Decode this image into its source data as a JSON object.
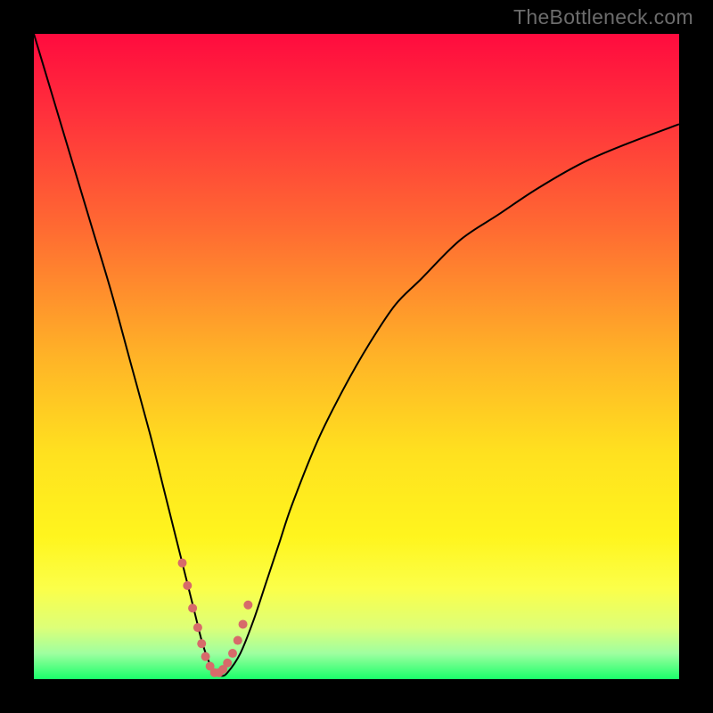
{
  "watermark": "TheBottleneck.com",
  "chart_data": {
    "type": "line",
    "title": "",
    "xlabel": "",
    "ylabel": "",
    "xlim": [
      0,
      100
    ],
    "ylim": [
      0,
      100
    ],
    "legend": false,
    "grid": false,
    "background": {
      "type": "vertical-gradient",
      "stops": [
        {
          "pos": 0.0,
          "color": "#ff0b3e"
        },
        {
          "pos": 0.12,
          "color": "#ff2f3c"
        },
        {
          "pos": 0.3,
          "color": "#ff6a32"
        },
        {
          "pos": 0.5,
          "color": "#ffb327"
        },
        {
          "pos": 0.65,
          "color": "#ffe11f"
        },
        {
          "pos": 0.78,
          "color": "#fff51e"
        },
        {
          "pos": 0.86,
          "color": "#fbff4a"
        },
        {
          "pos": 0.92,
          "color": "#ddff78"
        },
        {
          "pos": 0.96,
          "color": "#9fffa0"
        },
        {
          "pos": 1.0,
          "color": "#1aff6a"
        }
      ]
    },
    "series": [
      {
        "name": "bottleneck-curve",
        "color": "#000000",
        "width": 2,
        "x": [
          0,
          3,
          6,
          9,
          12,
          15,
          18,
          20,
          22,
          24,
          25,
          26,
          27,
          28,
          29,
          30,
          32,
          34,
          36,
          38,
          40,
          44,
          48,
          52,
          56,
          60,
          66,
          72,
          78,
          85,
          92,
          100
        ],
        "y": [
          100,
          90,
          80,
          70,
          60,
          49,
          38,
          30,
          22,
          14,
          10,
          6,
          3,
          1,
          0.5,
          1,
          4,
          9,
          15,
          21,
          27,
          37,
          45,
          52,
          58,
          62,
          68,
          72,
          76,
          80,
          83,
          86
        ]
      },
      {
        "name": "bottom-range-marker",
        "type": "marker",
        "color": "#d76a6a",
        "marker_size": 10,
        "x": [
          23.0,
          23.8,
          24.6,
          25.4,
          26.0,
          26.6,
          27.3,
          28.0,
          28.7,
          29.3,
          30.0,
          30.8,
          31.6,
          32.4,
          33.2
        ],
        "y": [
          18.0,
          14.5,
          11.0,
          8.0,
          5.5,
          3.5,
          2.0,
          1.0,
          1.0,
          1.5,
          2.5,
          4.0,
          6.0,
          8.5,
          11.5
        ]
      }
    ],
    "annotations": []
  }
}
